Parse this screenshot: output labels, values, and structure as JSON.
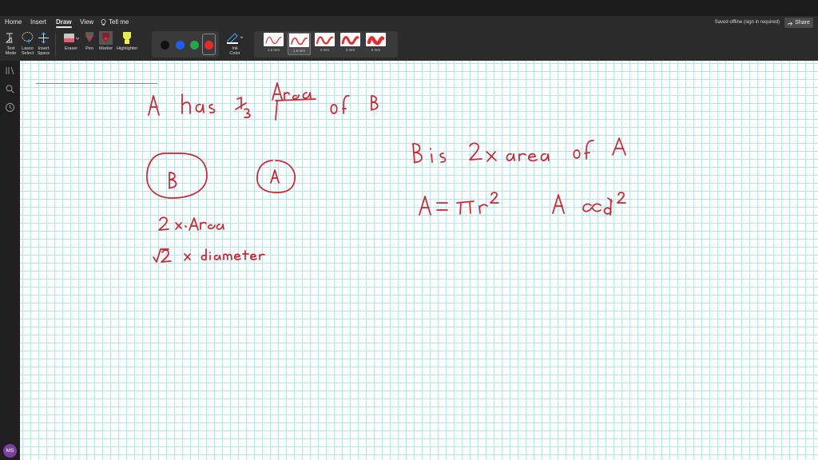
{
  "menu": {
    "home": "Home",
    "insert": "Insert",
    "draw": "Draw",
    "view": "View",
    "tell_me": "Tell me",
    "saved_status": "Saved offline (sign in required)",
    "share": "Share"
  },
  "tools": {
    "text_mode": [
      "Text",
      "Mode"
    ],
    "lasso_select": [
      "Lasso",
      "Select"
    ],
    "insert_space": [
      "Insert",
      "Space"
    ],
    "eraser": "Eraser",
    "pen": "Pen",
    "marker": "Marker",
    "highlighter": "Highlighter",
    "ink_color": [
      "Ink",
      "Color"
    ]
  },
  "pen_colors": [
    "#111111",
    "#1f5ee8",
    "#20a84a",
    "#e62b2b"
  ],
  "selected_color": "#e62b2b",
  "thickness": [
    "1.2 mm",
    "1.5 mm",
    "2 mm",
    "3 mm",
    "5 mm"
  ],
  "selected_thickness": "1.5 mm",
  "user": {
    "initials": "MS",
    "avatar_color": "#7b3fa0"
  },
  "ink_color": "#d2212b"
}
